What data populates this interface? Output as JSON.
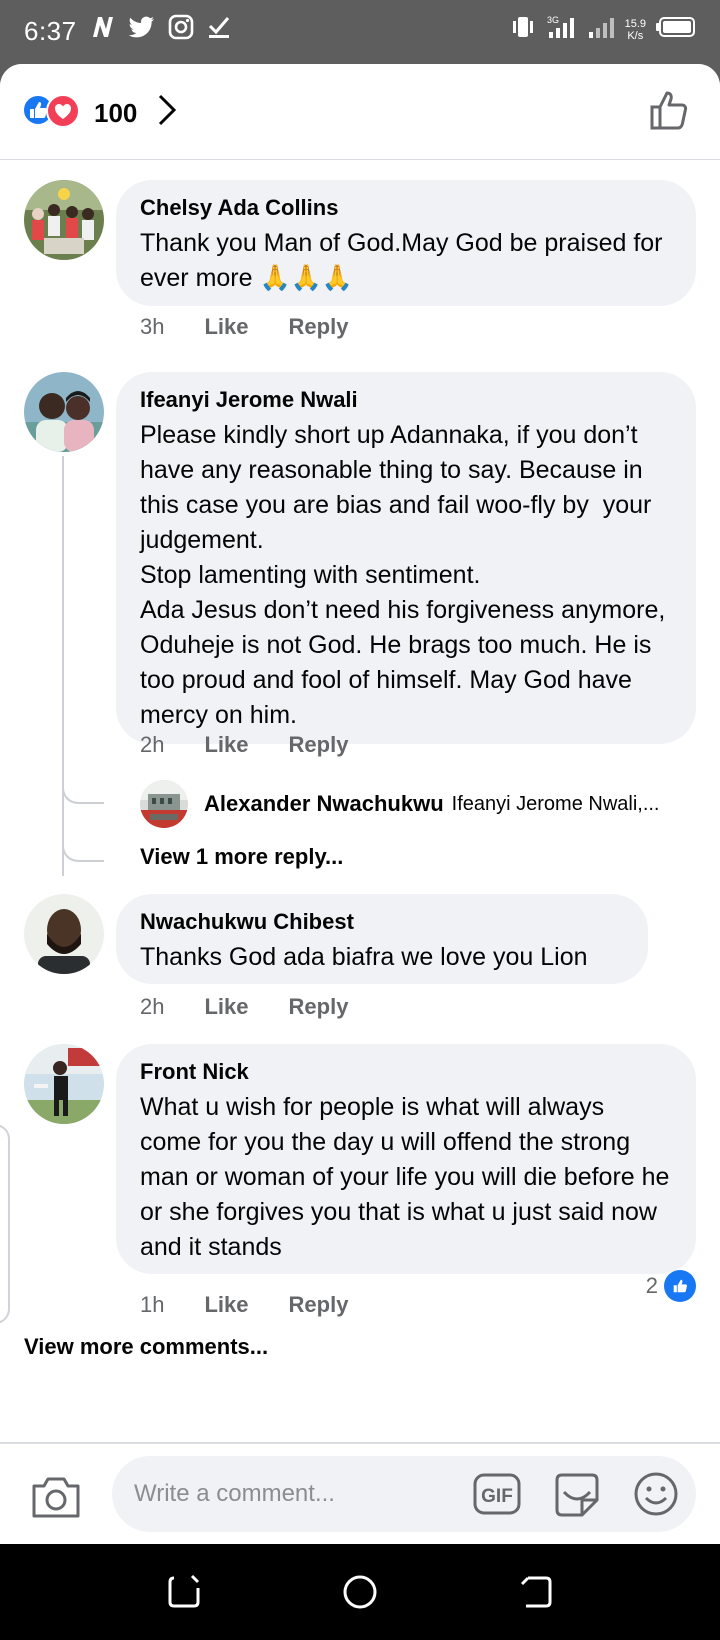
{
  "status_bar": {
    "time": "6:37",
    "network_speed_value": "15.9",
    "network_speed_unit": "K/s",
    "network_label": "3G"
  },
  "reactions": {
    "count": "100",
    "types": [
      "like-icon",
      "love-icon"
    ]
  },
  "comments": [
    {
      "author": "Chelsy Ada Collins",
      "text": "Thank you Man of God.May God be praised for ever more 🙏🙏🙏",
      "time": "3h",
      "like_label": "Like",
      "reply_label": "Reply"
    },
    {
      "author": "Ifeanyi Jerome Nwali",
      "text": "Please kindly short up Adannaka, if you don’t have any reasonable thing to say. Because in this case you are bias and fail woo-fly by  your judgement.\nStop lamenting with sentiment.\nAda Jesus don’t need his forgiveness anymore, Oduheje is not God. He brags too much. He is too proud and fool of himself. May God have mercy on him.",
      "time": "2h",
      "like_label": "Like",
      "reply_label": "Reply",
      "reply_preview": {
        "author": "Alexander Nwachukwu",
        "text": "Ifeanyi Jerome Nwali,..."
      },
      "view_more_replies": "View 1 more reply..."
    },
    {
      "author": "Nwachukwu Chibest",
      "text": "Thanks God ada biafra we love you Lion",
      "time": "2h",
      "like_label": "Like",
      "reply_label": "Reply"
    },
    {
      "author": "Front Nick",
      "text": "What u wish for people is what will always come for you the day u will offend the strong man or woman of your life you will die before he or she forgives you that is what u just said now and it stands",
      "time": "1h",
      "like_label": "Like",
      "reply_label": "Reply",
      "like_count": "2"
    }
  ],
  "view_more_comments": "View more comments...",
  "composer": {
    "placeholder": "Write a comment...",
    "gif_label": "GIF"
  },
  "colors": {
    "facebook_blue": "#1877f2",
    "love_red": "#f33e58",
    "bubble_gray": "#f0f2f5",
    "meta_gray": "#65676b"
  }
}
